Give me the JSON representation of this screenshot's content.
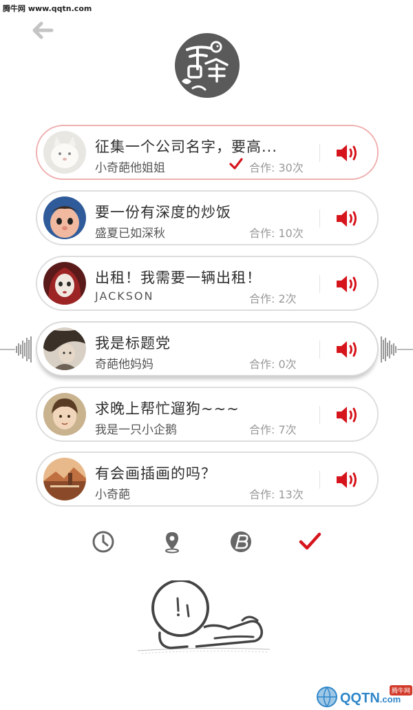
{
  "watermark_top": "腾牛网 www.qqtn.com",
  "logo_text": "干啥",
  "topics": [
    {
      "title": "征集一个公司名字，要高...",
      "author": "小奇葩他姐姐",
      "count": "合作: 30次",
      "checked": true
    },
    {
      "title": "要一份有深度的炒饭",
      "author": "盛夏已如深秋",
      "count": "合作: 10次"
    },
    {
      "title": "出租！我需要一辆出租！",
      "author": "JACKSON",
      "count": "合作: 2次"
    },
    {
      "title": "我是标题党",
      "author": "奇葩他妈妈",
      "count": "合作: 0次"
    },
    {
      "title": "求晚上帮忙遛狗~~~",
      "author": "我是一只小企鹅",
      "count": "合作: 7次"
    },
    {
      "title": "有会画插画的吗？",
      "author": "小奇葩",
      "count": "合作: 13次"
    }
  ],
  "tabs": [
    {
      "icon": "clock-icon"
    },
    {
      "icon": "location-pin-icon"
    },
    {
      "icon": "b-coin-icon"
    },
    {
      "icon": "checkmark-icon",
      "active": true
    }
  ],
  "colors": {
    "accent": "#d6141c",
    "icon_gray": "#666666",
    "card_border": "#dddddd"
  },
  "watermark_bottom": {
    "site": "QQTN",
    "suffix": ".com",
    "badge": "腾牛网"
  }
}
